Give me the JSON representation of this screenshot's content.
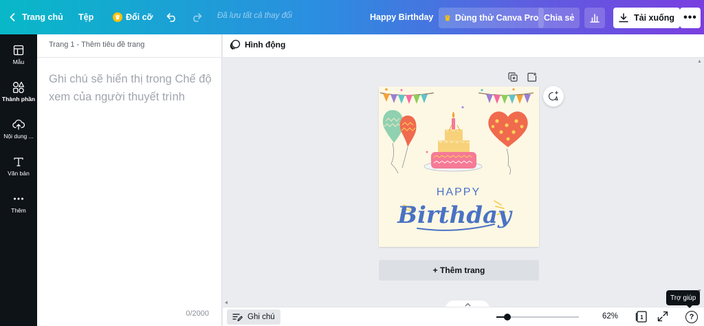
{
  "topbar": {
    "home_label": "Trang chủ",
    "file_label": "Tệp",
    "resize_label": "Đổi cỡ",
    "saved_status": "Đã lưu tất cả thay đổi",
    "document_title": "Happy Birthday",
    "pro_label": "Dùng thử Canva Pro",
    "share_label": "Chia sẻ",
    "download_label": "Tải xuống",
    "more_label": "•••"
  },
  "sidebar": {
    "items": [
      {
        "label": "Mẫu",
        "icon": "layout-icon"
      },
      {
        "label": "Thành phần",
        "icon": "shapes-icon"
      },
      {
        "label": "Nội dung ...",
        "icon": "cloud-upload-icon"
      },
      {
        "label": "Văn bản",
        "icon": "text-icon"
      },
      {
        "label": "Thêm",
        "icon": "more-dots-icon"
      }
    ]
  },
  "notes": {
    "header": "Trang 1 - Thêm tiêu đề trang",
    "placeholder": "Ghi chú sẽ hiển thị trong Chế độ xem của người thuyết trình",
    "char_count": "0/2000"
  },
  "canvas": {
    "animate_label": "Hình động",
    "add_page_label": "+ Thêm trang",
    "card_text": {
      "happy": "HAPPY",
      "birthday": "Birthday"
    }
  },
  "bottom": {
    "notes_label": "Ghi chú",
    "zoom": "62%",
    "zoom_fraction": 0.62,
    "page_count": "1",
    "help_tooltip": "Trợ giúp",
    "help_label": "?"
  },
  "colors": {
    "rail_bg": "#0e1318",
    "accent_start": "#08b8c8",
    "accent_end": "#7a3fe0",
    "card_bg": "#fdf8e4",
    "lettering": "#4a72c4"
  }
}
